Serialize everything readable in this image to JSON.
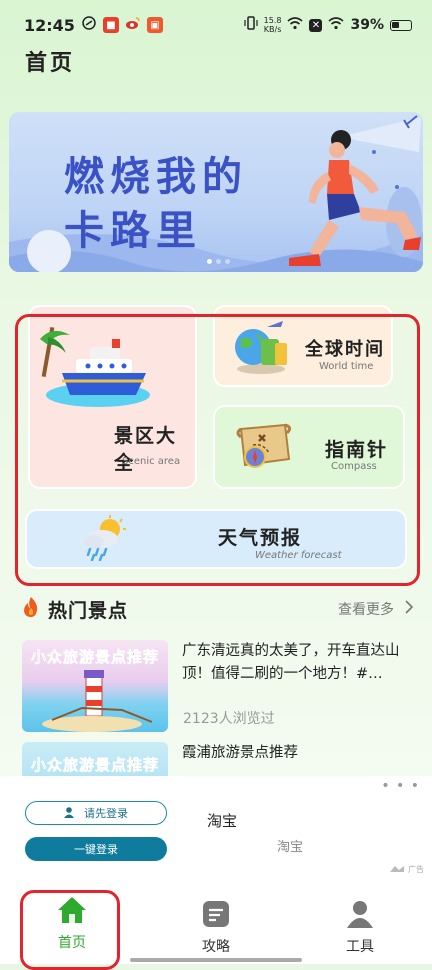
{
  "status_bar": {
    "time": "12:45",
    "net_speed_value": "15.8",
    "net_speed_unit": "KB/s",
    "battery": "39%"
  },
  "page": {
    "title": "首页"
  },
  "banner": {
    "text": "燃烧我的\n卡路里"
  },
  "features": {
    "scenic": {
      "title": "景区大全",
      "subtitle": "Scenic area"
    },
    "world_time": {
      "title": "全球时间",
      "subtitle": "World time"
    },
    "compass": {
      "title": "指南针",
      "subtitle": "Compass"
    },
    "weather": {
      "title": "天气预报",
      "subtitle": "Weather forecast"
    }
  },
  "hot_spots": {
    "title": "热门景点",
    "more": "查看更多",
    "articles": [
      {
        "thumb_label": "小众旅游景点推荐",
        "title": "广东清远真的太美了，开车直达山顶！值得二刷的一个地方！#…",
        "views": "2123人浏览过"
      },
      {
        "thumb_label": "小众旅游景点推荐",
        "title": "霞浦旅游景点推荐"
      }
    ]
  },
  "ad": {
    "login_label": "请先登录",
    "onekey_label": "一键登录",
    "name": "淘宝",
    "sub": "淘宝",
    "tag": "广告",
    "more_dots": "• • •"
  },
  "nav": {
    "items": [
      {
        "label": "首页",
        "icon": "home-icon",
        "active": true
      },
      {
        "label": "攻略",
        "icon": "guide-icon",
        "active": false
      },
      {
        "label": "工具",
        "icon": "tools-icon",
        "active": false
      }
    ],
    "active_color": "#2faa2f",
    "inactive_color": "#333333"
  },
  "colors": {
    "highlight_border": "#e5232c",
    "background": "#e8f7e4"
  }
}
